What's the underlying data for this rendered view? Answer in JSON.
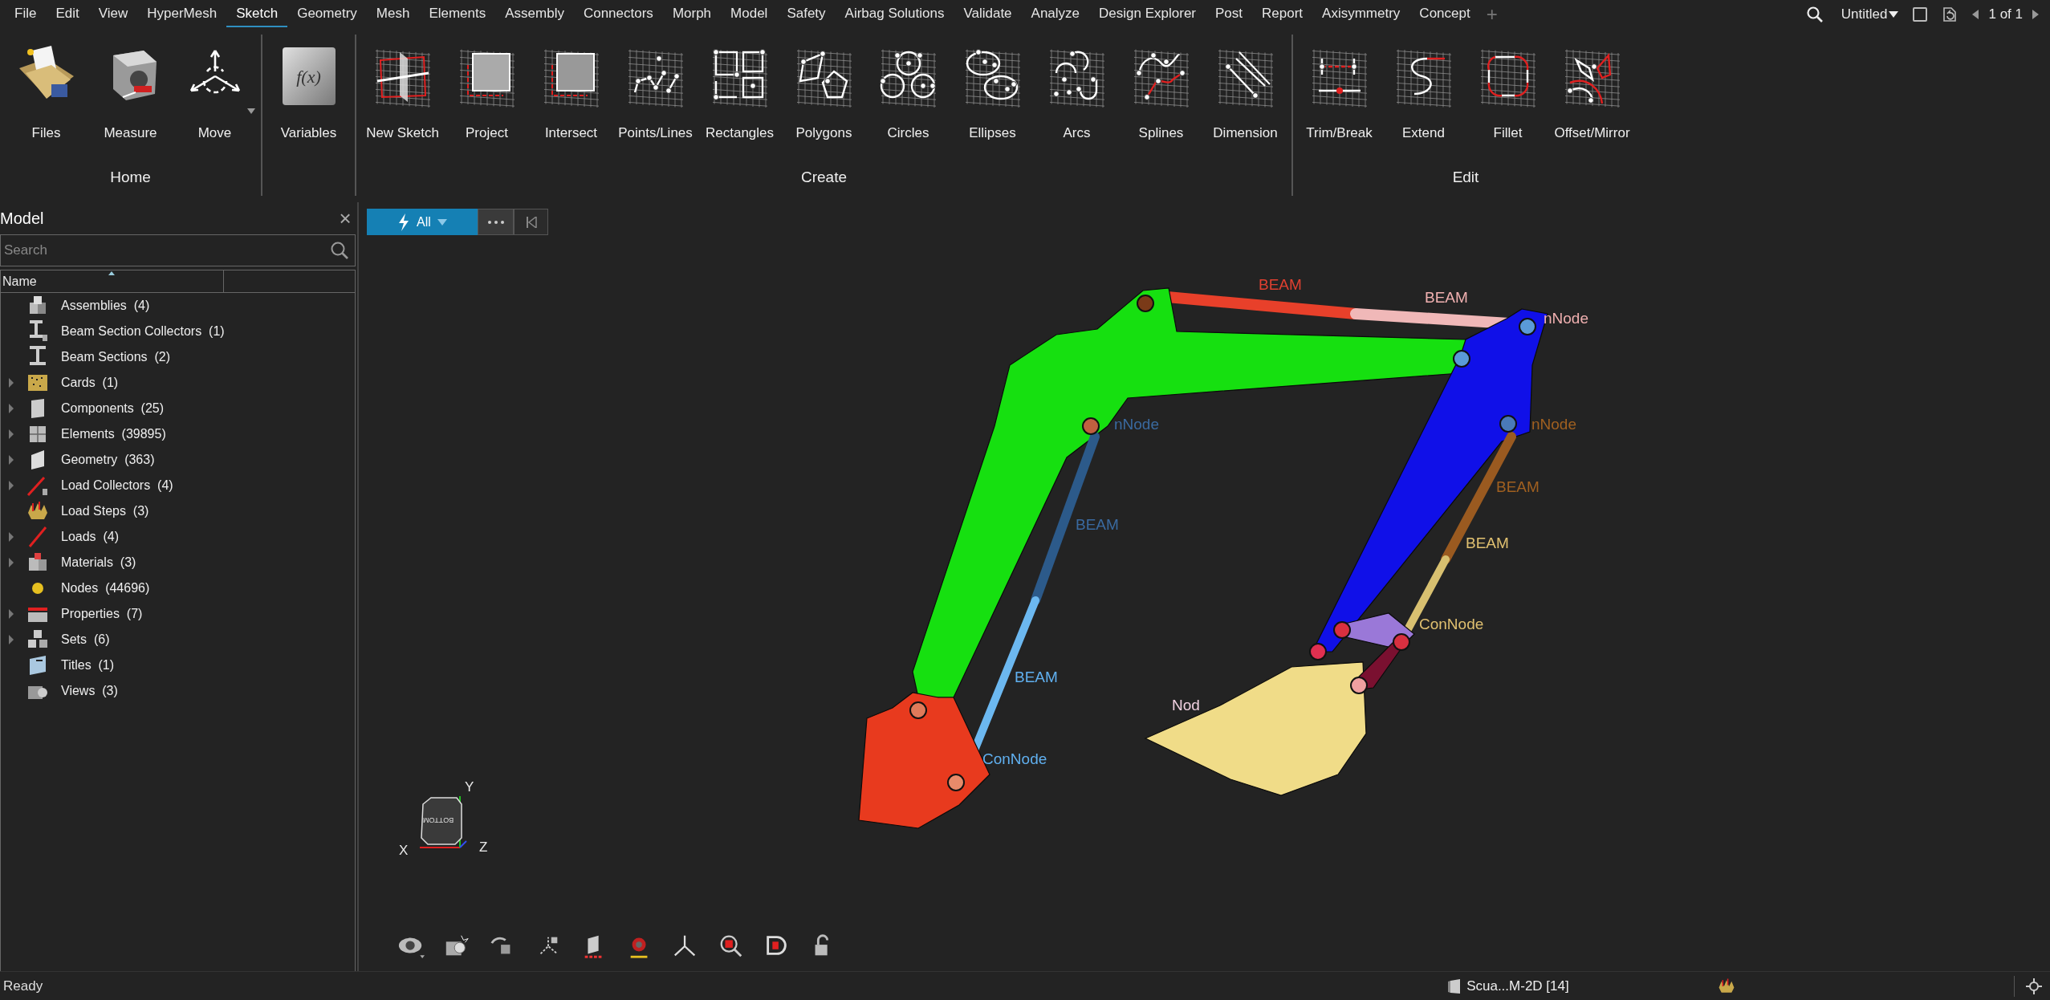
{
  "menu_bar": {
    "items": [
      {
        "label": "File",
        "selected": false
      },
      {
        "label": "Edit",
        "selected": false
      },
      {
        "label": "View",
        "selected": false
      },
      {
        "label": "HyperMesh",
        "selected": false
      },
      {
        "label": "Sketch",
        "selected": true
      },
      {
        "label": "Geometry",
        "selected": false
      },
      {
        "label": "Mesh",
        "selected": false
      },
      {
        "label": "Elements",
        "selected": false
      },
      {
        "label": "Assembly",
        "selected": false
      },
      {
        "label": "Connectors",
        "selected": false
      },
      {
        "label": "Morph",
        "selected": false
      },
      {
        "label": "Model",
        "selected": false
      },
      {
        "label": "Safety",
        "selected": false
      },
      {
        "label": "Airbag Solutions",
        "selected": false
      },
      {
        "label": "Validate",
        "selected": false
      },
      {
        "label": "Analyze",
        "selected": false
      },
      {
        "label": "Design Explorer",
        "selected": false
      },
      {
        "label": "Post",
        "selected": false
      },
      {
        "label": "Report",
        "selected": false
      },
      {
        "label": "Axisymmetry",
        "selected": false
      },
      {
        "label": "Concept",
        "selected": false
      }
    ],
    "add_tab": "+",
    "session": "Untitled",
    "page": "1 of 1"
  },
  "ribbon": {
    "groups": [
      {
        "label": "Home",
        "buttons": [
          {
            "label": "Files"
          },
          {
            "label": "Measure"
          },
          {
            "label": "Move",
            "has_menu": true
          }
        ]
      },
      {
        "buttons": [
          {
            "label": "Variables",
            "icon_text": "f(x)"
          }
        ]
      },
      {
        "label": "Create",
        "buttons": [
          {
            "label": "New Sketch"
          },
          {
            "label": "Project"
          },
          {
            "label": "Intersect"
          },
          {
            "label": "Points/Lines"
          },
          {
            "label": "Rectangles"
          },
          {
            "label": "Polygons"
          },
          {
            "label": "Circles"
          },
          {
            "label": "Ellipses"
          },
          {
            "label": "Arcs"
          },
          {
            "label": "Splines"
          },
          {
            "label": "Dimension"
          }
        ]
      },
      {
        "label": "Edit",
        "buttons": [
          {
            "label": "Trim/Break"
          },
          {
            "label": "Extend"
          },
          {
            "label": "Fillet"
          },
          {
            "label": "Offset/Mirror"
          }
        ]
      }
    ]
  },
  "model_panel": {
    "title": "Model",
    "close": "×",
    "search": {
      "placeholder": "Search"
    },
    "columns": [
      "Name"
    ],
    "items": [
      {
        "label": "Assemblies",
        "count": "(4)",
        "expandable": false
      },
      {
        "label": "Beam Section Collectors",
        "count": "(1)",
        "expandable": false
      },
      {
        "label": "Beam Sections",
        "count": "(2)",
        "expandable": false
      },
      {
        "label": "Cards",
        "count": "(1)",
        "expandable": true
      },
      {
        "label": "Components",
        "count": "(25)",
        "expandable": true
      },
      {
        "label": "Elements",
        "count": "(39895)",
        "expandable": true
      },
      {
        "label": "Geometry",
        "count": "(363)",
        "expandable": true
      },
      {
        "label": "Load Collectors",
        "count": "(4)",
        "expandable": true
      },
      {
        "label": "Load Steps",
        "count": "(3)",
        "expandable": false
      },
      {
        "label": "Loads",
        "count": "(4)",
        "expandable": true
      },
      {
        "label": "Materials",
        "count": "(3)",
        "expandable": true
      },
      {
        "label": "Nodes",
        "count": "(44696)",
        "expandable": false
      },
      {
        "label": "Properties",
        "count": "(7)",
        "expandable": true
      },
      {
        "label": "Sets",
        "count": "(6)",
        "expandable": true
      },
      {
        "label": "Titles",
        "count": "(1)",
        "expandable": false
      },
      {
        "label": "Views",
        "count": "(3)",
        "expandable": false
      }
    ]
  },
  "viewport": {
    "filter": {
      "label": "All"
    },
    "labels": [
      {
        "text": "BEAM",
        "color": "#e04030"
      },
      {
        "text": "BEAM",
        "color": "#f0b0b0"
      },
      {
        "text": "nNode",
        "color": "#f0b0b0"
      },
      {
        "text": "nNode",
        "color": "#3a6aa0"
      },
      {
        "text": "nNode",
        "color": "#a06020"
      },
      {
        "text": "BEAM",
        "color": "#a06020"
      },
      {
        "text": "BEAM",
        "color": "#3a6aa0"
      },
      {
        "text": "BEAM",
        "color": "#e0c070"
      },
      {
        "text": "ConNode",
        "color": "#e0c070"
      },
      {
        "text": "BEAM",
        "color": "#60b0f0"
      },
      {
        "text": "ConNode",
        "color": "#60b0f0"
      },
      {
        "text": "Nod",
        "color": "#f0d0e0"
      }
    ],
    "triad": {
      "x": "X",
      "y": "Y",
      "z": "Z",
      "cube_face": "BOTTOM"
    }
  },
  "status_bar": {
    "message": "Ready",
    "model": "Scua...M-2D [14]"
  }
}
